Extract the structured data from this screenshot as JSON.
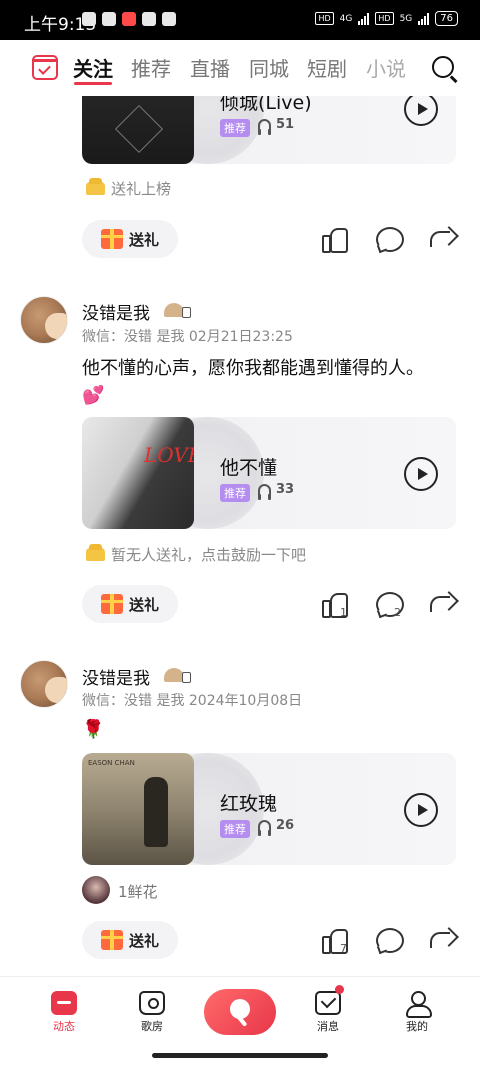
{
  "status_bar": {
    "time": "上午9:13",
    "battery": "76",
    "net_labels": [
      "HD",
      "4G",
      "HD",
      "5G"
    ]
  },
  "tabs": [
    "关注",
    "推荐",
    "直播",
    "同城",
    "短剧",
    "小说"
  ],
  "active_tab": "关注",
  "posts": [
    {
      "song_title": "倾城(Live)",
      "tag": "推荐",
      "listen_count": "51",
      "gift_text": "送礼上榜",
      "gift_button": "送礼"
    },
    {
      "username": "没错是我",
      "meta": "微信：没错 是我 02月21日23:25",
      "text": "他不懂的心声，愿你我都能遇到懂得的人。",
      "emoji": "💕",
      "song_title": "他不懂",
      "tag": "推荐",
      "listen_count": "33",
      "gift_text": "暂无人送礼，点击鼓励一下吧",
      "gift_button": "送礼",
      "likes": "1",
      "comments": "2"
    },
    {
      "username": "没错是我",
      "meta": "微信：没错 是我 2024年10月08日",
      "emoji": "🌹",
      "song_title": "红玫瑰",
      "tag": "推荐",
      "listen_count": "26",
      "gift_text": "1鲜花",
      "gift_button": "送礼",
      "likes": "7"
    }
  ],
  "cover_text": {
    "cover2": "LOVE",
    "cover3": "EASON CHAN"
  },
  "bottom_nav": [
    "动态",
    "歌房",
    "消息",
    "我的"
  ],
  "colors": {
    "accent": "#e8364a",
    "tag": "#b58cf0"
  },
  "icons": [
    "calendar-icon",
    "search-icon",
    "play-icon",
    "headphone-icon",
    "sofa-icon",
    "gift-icon",
    "like-icon",
    "comment-icon",
    "share-icon"
  ]
}
